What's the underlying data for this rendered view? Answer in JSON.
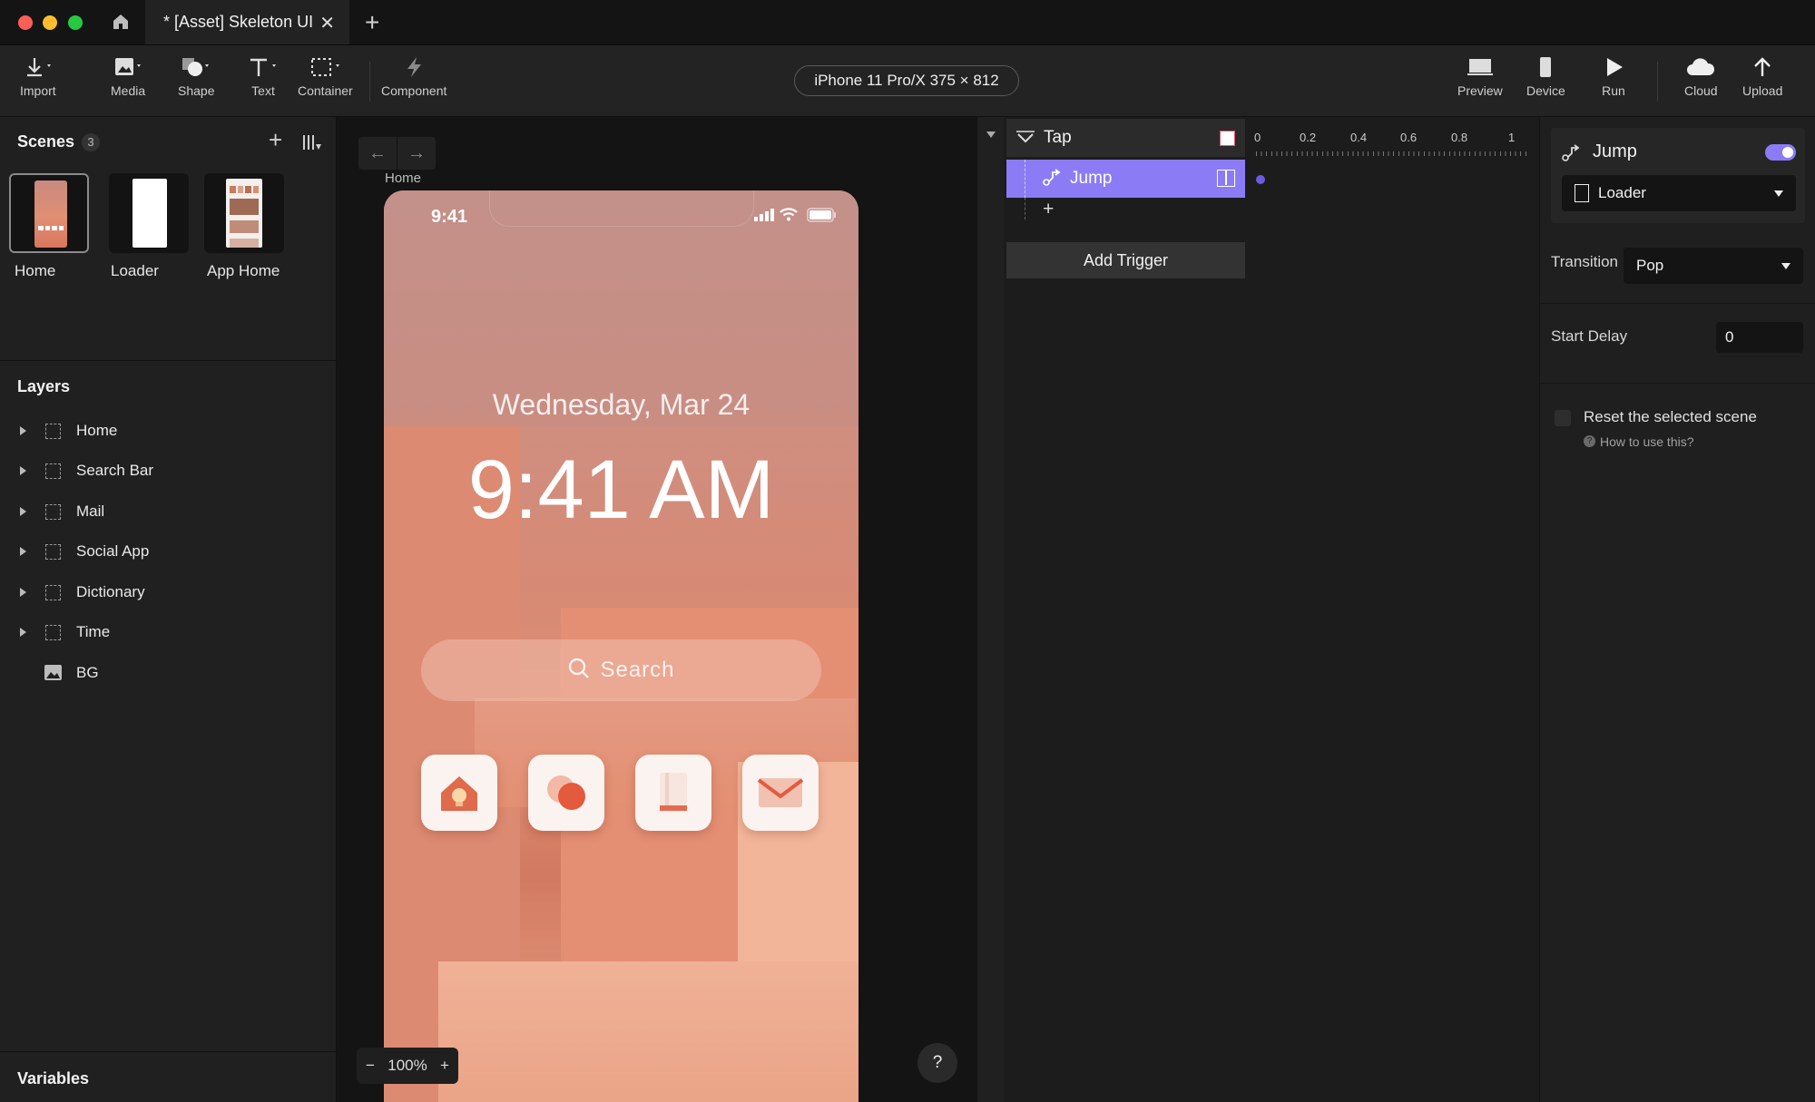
{
  "window": {
    "tab_title": "* [Asset] Skeleton UI"
  },
  "toolbar": {
    "import": "Import",
    "media": "Media",
    "shape": "Shape",
    "text": "Text",
    "container": "Container",
    "component": "Component",
    "device_label": "iPhone 11 Pro/X  375 × 812",
    "preview": "Preview",
    "device": "Device",
    "run": "Run",
    "cloud": "Cloud",
    "upload": "Upload"
  },
  "scenes": {
    "title": "Scenes",
    "count": "3",
    "items": [
      {
        "label": "Home"
      },
      {
        "label": "Loader"
      },
      {
        "label": "App Home"
      }
    ]
  },
  "layers": {
    "title": "Layers",
    "items": [
      {
        "label": "Home"
      },
      {
        "label": "Search Bar"
      },
      {
        "label": "Mail"
      },
      {
        "label": "Social App"
      },
      {
        "label": "Dictionary"
      },
      {
        "label": "Time"
      },
      {
        "label": "BG"
      }
    ]
  },
  "variables": {
    "title": "Variables"
  },
  "canvas": {
    "breadcrumb": "Home",
    "zoom": "100%",
    "help": "?",
    "phone": {
      "status_time": "9:41",
      "date": "Wednesday, Mar 24",
      "time": "9:41 AM",
      "search_placeholder": "Search"
    }
  },
  "triggers": {
    "trigger_label": "Tap",
    "response_label": "Jump",
    "add_trigger": "Add Trigger",
    "timeline_ticks": [
      "0",
      "0.2",
      "0.4",
      "0.6",
      "0.8",
      "1"
    ]
  },
  "props": {
    "title": "Jump",
    "toggle_on": true,
    "target_scene": "Loader",
    "transition_label": "Transition",
    "transition_value": "Pop",
    "start_delay_label": "Start Delay",
    "start_delay_value": "0",
    "reset_label": "Reset the selected scene",
    "help_link": "How to use this?"
  },
  "colors": {
    "accent": "#8b7cf6",
    "canvas_bg": "#141414",
    "panel_bg": "#202020"
  }
}
